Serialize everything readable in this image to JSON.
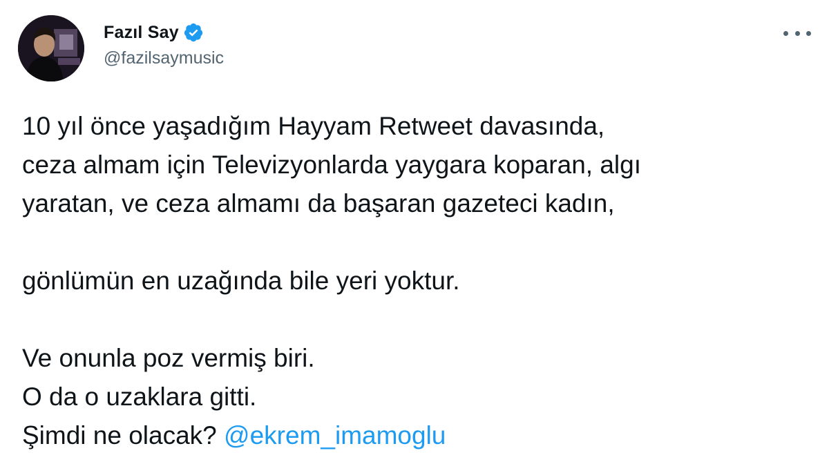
{
  "author": {
    "display_name": "Fazıl Say",
    "handle": "@fazilsaymusic",
    "verified_icon": "verified-badge-icon",
    "avatar_icon": "profile-photo"
  },
  "menu": {
    "icon": "more-options-icon"
  },
  "tweet": {
    "lines": [
      "10 yıl önce yaşadığım Hayyam Retweet davasında,",
      "ceza almam için Televizyonlarda yaygara koparan, algı",
      "yaratan, ve ceza almamı da başaran gazeteci kadın,",
      "gönlümün en uzağında bile yeri yoktur.",
      "Ve onunla poz vermiş biri.",
      "O da o uzaklara gitti.",
      "Şimdi ne olacak?"
    ],
    "mention": "@ekrem_imamoglu"
  },
  "colors": {
    "text": "#0f1419",
    "secondary": "#536471",
    "accent": "#1d9bf0"
  }
}
